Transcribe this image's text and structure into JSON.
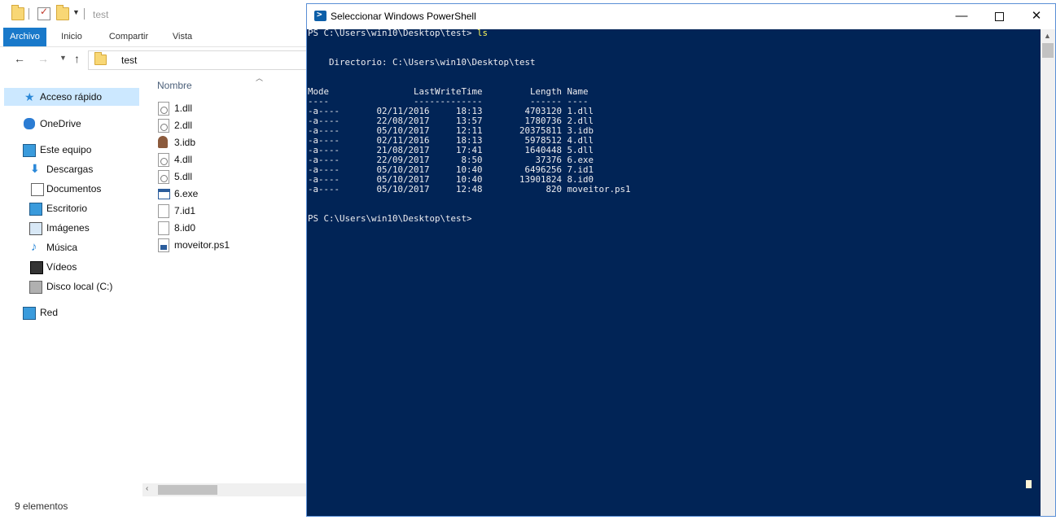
{
  "explorer": {
    "title": "test",
    "ribbon_tabs": [
      "Archivo",
      "Inicio",
      "Compartir",
      "Vista"
    ],
    "address_path": "test",
    "nav": {
      "quick_access": "Acceso rápido",
      "onedrive": "OneDrive",
      "this_pc": "Este equipo",
      "downloads": "Descargas",
      "documents": "Documentos",
      "desktop": "Escritorio",
      "pictures": "Imágenes",
      "music": "Música",
      "videos": "Vídeos",
      "local_disk": "Disco local (C:)",
      "network": "Red"
    },
    "column_name": "Nombre",
    "files": [
      "1.dll",
      "2.dll",
      "3.idb",
      "4.dll",
      "5.dll",
      "6.exe",
      "7.id1",
      "8.id0",
      "moveitor.ps1"
    ],
    "status": "9 elementos"
  },
  "powershell": {
    "title": "Seleccionar Windows PowerShell",
    "prompt": "PS C:\\Users\\win10\\Desktop\\test> ",
    "command": "ls",
    "directory_line": "    Directorio: C:\\Users\\win10\\Desktop\\test",
    "header_line": "Mode                LastWriteTime         Length Name",
    "separator_line": "----                -------------         ------ ----",
    "rows": [
      {
        "mode": "-a----",
        "date": "02/11/2016",
        "time": "18:13",
        "length": "4703120",
        "name": "1.dll"
      },
      {
        "mode": "-a----",
        "date": "22/08/2017",
        "time": "13:57",
        "length": "1780736",
        "name": "2.dll"
      },
      {
        "mode": "-a----",
        "date": "05/10/2017",
        "time": "12:11",
        "length": "20375811",
        "name": "3.idb"
      },
      {
        "mode": "-a----",
        "date": "02/11/2016",
        "time": "18:13",
        "length": "5978512",
        "name": "4.dll"
      },
      {
        "mode": "-a----",
        "date": "21/08/2017",
        "time": "17:41",
        "length": "1640448",
        "name": "5.dll"
      },
      {
        "mode": "-a----",
        "date": "22/09/2017",
        "time": "8:50",
        "length": "37376",
        "name": "6.exe"
      },
      {
        "mode": "-a----",
        "date": "05/10/2017",
        "time": "10:40",
        "length": "6496256",
        "name": "7.id1"
      },
      {
        "mode": "-a----",
        "date": "05/10/2017",
        "time": "10:40",
        "length": "13901824",
        "name": "8.id0"
      },
      {
        "mode": "-a----",
        "date": "05/10/2017",
        "time": "12:48",
        "length": "820",
        "name": "moveitor.ps1"
      }
    ],
    "colors": {
      "background": "#012456",
      "text": "#eeedf0",
      "command": "#fff85a"
    }
  }
}
